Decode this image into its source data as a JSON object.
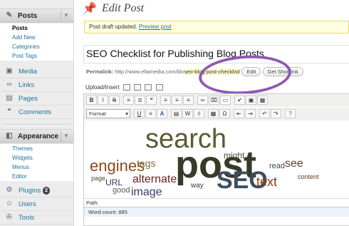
{
  "sidebar": {
    "posts": {
      "label": "Posts",
      "sub": [
        "Posts",
        "Add New",
        "Categories",
        "Post Tags"
      ]
    },
    "media": "Media",
    "links": "Links",
    "pages": "Pages",
    "comments": "Comments",
    "appearance": {
      "label": "Appearance",
      "sub": [
        "Themes",
        "Widgets",
        "Menus",
        "Editor"
      ]
    },
    "plugins": {
      "label": "Plugins",
      "badge": "2"
    },
    "users": "Users",
    "tools": "Tools"
  },
  "page": {
    "title": "Edit Post",
    "notice": "Post draft updated.",
    "notice_link": "Preview post",
    "post_title": "SEO Checklist for Publishing Blog Posts",
    "permalink_label": "Permalink:",
    "permalink_base": "http://www.ellamedia.com/blo",
    "permalink_slug": "seo-blog-post-checklist/",
    "edit_button": "Edit",
    "shortlink_button": "Get Shortlink",
    "upload_label": "Upload/Insert",
    "format_select": "Format",
    "path_label": "Path:",
    "word_count": "Word count: 885"
  },
  "icons": [
    "posts-icon",
    "media-icon",
    "links-icon",
    "pages-icon",
    "comments-icon",
    "appearance-icon",
    "plugins-icon",
    "users-icon",
    "tools-icon",
    "pin-icon"
  ],
  "colors": {
    "annotation": "#8e58b2",
    "link": "#21759b",
    "notice_bg": "#ffffe0"
  },
  "wordcloud": [
    {
      "text": "search"
    },
    {
      "text": "post"
    },
    {
      "text": "engines"
    },
    {
      "text": "SEO"
    },
    {
      "text": "alternate"
    },
    {
      "text": "tags"
    },
    {
      "text": "text"
    },
    {
      "text": "image"
    },
    {
      "text": "might"
    },
    {
      "text": "URL"
    },
    {
      "text": "good"
    },
    {
      "text": "see"
    },
    {
      "text": "read"
    },
    {
      "text": "content"
    },
    {
      "text": "page"
    },
    {
      "text": "way"
    }
  ]
}
